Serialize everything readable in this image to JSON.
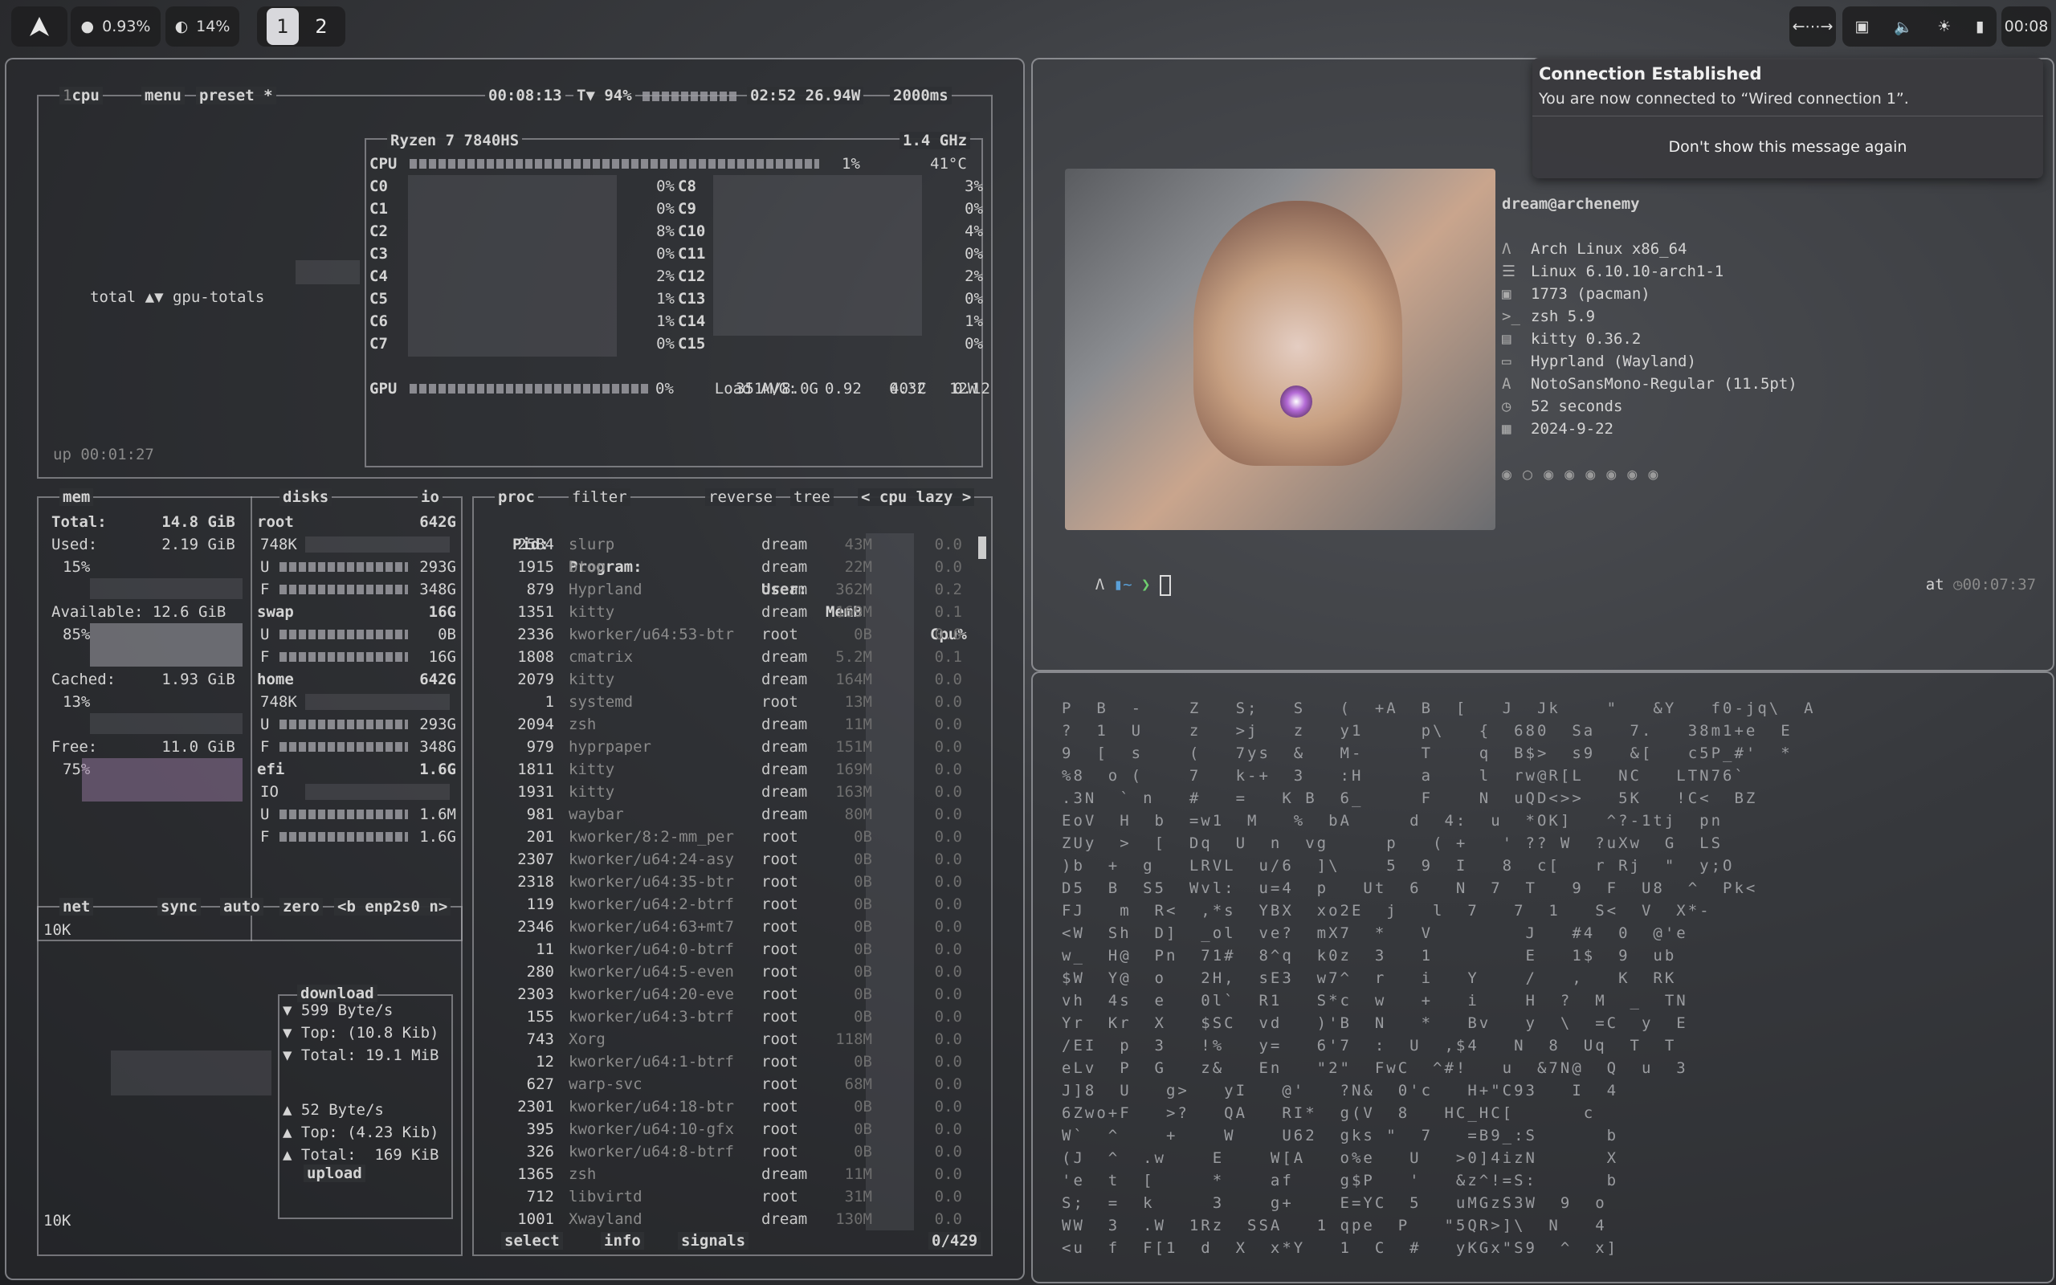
{
  "topbar": {
    "cpu": "0.93%",
    "ram": "14%",
    "workspaces": [
      "1",
      "2"
    ],
    "active_workspace": "1",
    "clock": "00:08",
    "icons": [
      "arch-logo-icon",
      "cpu-icon",
      "ram-icon",
      "network-arrows-icon",
      "display-icon",
      "volume-icon",
      "brightness-icon",
      "battery-icon"
    ]
  },
  "btop": {
    "cpu_box": {
      "tabs": [
        "cpu",
        "menu",
        "preset *"
      ],
      "tab_nums": [
        "1",
        "",
        "p"
      ],
      "uptime_clock": "00:08:13",
      "battery": "T▼ 94%",
      "battery_time": "02:52 26.94W",
      "interval": "2000ms",
      "total_label": "total ▲▼ gpu-totals",
      "up": "up 00:01:27",
      "cpu_name": "Ryzen 7 7840HS",
      "freq": "1.4 GHz",
      "cpu_total_label": "CPU",
      "cpu_total_pct": "1%",
      "cpu_temp": "41°C",
      "cores_left": [
        {
          "name": "C0",
          "pct": "0%"
        },
        {
          "name": "C1",
          "pct": "0%"
        },
        {
          "name": "C2",
          "pct": "8%"
        },
        {
          "name": "C3",
          "pct": "0%"
        },
        {
          "name": "C4",
          "pct": "2%"
        },
        {
          "name": "C5",
          "pct": "1%"
        },
        {
          "name": "C6",
          "pct": "1%"
        },
        {
          "name": "C7",
          "pct": "0%"
        }
      ],
      "cores_right": [
        {
          "name": "C8",
          "pct": "3%"
        },
        {
          "name": "C9",
          "pct": "0%"
        },
        {
          "name": "C10",
          "pct": "4%"
        },
        {
          "name": "C11",
          "pct": "0%"
        },
        {
          "name": "C12",
          "pct": "2%"
        },
        {
          "name": "C13",
          "pct": "0%"
        },
        {
          "name": "C14",
          "pct": "1%"
        },
        {
          "name": "C15",
          "pct": "0%"
        }
      ],
      "load_avg_label": "Load AVG:",
      "load_avg": [
        "0.92",
        "0.32",
        "0.12"
      ],
      "gpu_label": "GPU",
      "gpu_pct": "0%",
      "gpu_mem": "351M/8.0G",
      "gpu_temp": "40°C",
      "gpu_power": "12W"
    },
    "mem_box": {
      "title": "mem",
      "total_label": "Total:",
      "total": "14.8 GiB",
      "used_label": "Used:",
      "used": "2.19 GiB",
      "used_pct": "15%",
      "avail_label": "Available:",
      "avail": "12.6 GiB",
      "avail_pct": "85%",
      "cached_label": "Cached:",
      "cached": "1.93 GiB",
      "cached_pct": "13%",
      "free_label": "Free:",
      "free": "11.0 GiB",
      "free_pct": "75%"
    },
    "disks_box": {
      "title": "disks",
      "io": "io",
      "disks": [
        {
          "name": "root",
          "size": "642G",
          "io": "748K",
          "u": "293G",
          "f": "348G"
        },
        {
          "name": "swap",
          "size": "16G",
          "u": "0B",
          "f": "16G"
        },
        {
          "name": "home",
          "size": "642G",
          "io": "748K",
          "u": "293G",
          "f": "348G"
        },
        {
          "name": "efi",
          "size": "1.6G",
          "io": "IO",
          "u": "1.6M",
          "f": "1.6G"
        }
      ]
    },
    "net_box": {
      "title": "net",
      "tabs": [
        "sync",
        "auto",
        "zero",
        "<b enp2s0 n>"
      ],
      "scale_top": "10K",
      "scale_bottom": "10K",
      "download_title": "download",
      "down_rate": "599 Byte/s",
      "down_top": "Top: (10.8 Kib)",
      "down_total": "Total: 19.1 MiB",
      "up_rate": "52 Byte/s",
      "up_top": "Top: (4.23 Kib)",
      "up_total": "Total:  169 KiB",
      "upload_title": "upload"
    },
    "proc_box": {
      "title": "proc",
      "tabs": [
        "filter",
        "reverse",
        "tree",
        "< cpu lazy >"
      ],
      "headers": {
        "pid": "Pid:",
        "program": "Program:",
        "user": "User:",
        "mem": "MemB",
        "cpu": "Cpu%"
      },
      "rows": [
        [
          "2584",
          "slurp",
          "dream",
          "43M",
          "0.0"
        ],
        [
          "1915",
          "btop",
          "dream",
          "22M",
          "0.0"
        ],
        [
          "879",
          "Hyprland",
          "dream",
          "362M",
          "0.2"
        ],
        [
          "1351",
          "kitty",
          "dream",
          "169M",
          "0.1"
        ],
        [
          "2336",
          "kworker/u64:53-btr",
          "root",
          "0B",
          "0.0"
        ],
        [
          "1808",
          "cmatrix",
          "dream",
          "5.2M",
          "0.1"
        ],
        [
          "2079",
          "kitty",
          "dream",
          "164M",
          "0.0"
        ],
        [
          "1",
          "systemd",
          "root",
          "13M",
          "0.0"
        ],
        [
          "2094",
          "zsh",
          "dream",
          "11M",
          "0.0"
        ],
        [
          "979",
          "hyprpaper",
          "dream",
          "151M",
          "0.0"
        ],
        [
          "1811",
          "kitty",
          "dream",
          "169M",
          "0.0"
        ],
        [
          "1931",
          "kitty",
          "dream",
          "163M",
          "0.0"
        ],
        [
          "981",
          "waybar",
          "dream",
          "80M",
          "0.0"
        ],
        [
          "201",
          "kworker/8:2-mm_per",
          "root",
          "0B",
          "0.0"
        ],
        [
          "2307",
          "kworker/u64:24-asy",
          "root",
          "0B",
          "0.0"
        ],
        [
          "2318",
          "kworker/u64:35-btr",
          "root",
          "0B",
          "0.0"
        ],
        [
          "119",
          "kworker/u64:2-btrf",
          "root",
          "0B",
          "0.0"
        ],
        [
          "2346",
          "kworker/u64:63+mt7",
          "root",
          "0B",
          "0.0"
        ],
        [
          "11",
          "kworker/u64:0-btrf",
          "root",
          "0B",
          "0.0"
        ],
        [
          "280",
          "kworker/u64:5-even",
          "root",
          "0B",
          "0.0"
        ],
        [
          "2303",
          "kworker/u64:20-eve",
          "root",
          "0B",
          "0.0"
        ],
        [
          "155",
          "kworker/u64:3-btrf",
          "root",
          "0B",
          "0.0"
        ],
        [
          "743",
          "Xorg",
          "root",
          "118M",
          "0.0"
        ],
        [
          "12",
          "kworker/u64:1-btrf",
          "root",
          "0B",
          "0.0"
        ],
        [
          "627",
          "warp-svc",
          "root",
          "68M",
          "0.0"
        ],
        [
          "2301",
          "kworker/u64:18-btr",
          "root",
          "0B",
          "0.0"
        ],
        [
          "395",
          "kworker/u64:10-gfx",
          "root",
          "0B",
          "0.0"
        ],
        [
          "326",
          "kworker/u64:8-btrf",
          "root",
          "0B",
          "0.0"
        ],
        [
          "1365",
          "zsh",
          "dream",
          "11M",
          "0.0"
        ],
        [
          "712",
          "libvirtd",
          "root",
          "31M",
          "0.0"
        ],
        [
          "1001",
          "Xwayland",
          "dream",
          "130M",
          "0.0"
        ]
      ],
      "footer": {
        "select": "select",
        "info": "info",
        "signals": "signals",
        "count": "0/429"
      }
    }
  },
  "fetch": {
    "user_host": "dream@archenemy",
    "lines": [
      {
        "icon": "arch-icon",
        "text": "Arch Linux x86_64"
      },
      {
        "icon": "kernel-icon",
        "text": "Linux 6.10.10-arch1-1"
      },
      {
        "icon": "package-icon",
        "text": "1773 (pacman)"
      },
      {
        "icon": "shell-icon",
        "text": "zsh 5.9"
      },
      {
        "icon": "terminal-icon",
        "text": "kitty 0.36.2"
      },
      {
        "icon": "window-icon",
        "text": "Hyprland (Wayland)"
      },
      {
        "icon": "font-icon",
        "text": "NotoSansMono-Regular (11.5pt)"
      },
      {
        "icon": "clock-icon",
        "text": "52 seconds"
      },
      {
        "icon": "calendar-icon",
        "text": "2024-9-22"
      }
    ],
    "prompt_symbol": "❯",
    "prompt_time_label": "at",
    "prompt_time": "00:07:37"
  },
  "notification": {
    "title": "Connection Established",
    "body": "You are now connected to “Wired connection 1”.",
    "action": "Don't show this message again"
  },
  "matrix": {
    "lines": [
      "P  B  -    Z   S;   S   (  +A  B  [   J  Jk    \"   &Y   f0-jq\\  A",
      "?  1  U    z   >j   z   y1     p\\   {  680  Sa   7.   38m1+e  E",
      "9  [  s    (   7ys  &   M-     T    q  B$>  s9   &[   c5P_#'  *",
      "%8  o (    7   k-+  3   :H     a    l  rw@R[L   NC   LTN76`",
      ".3N  ` n   #   =   K B  6_     F    N  uQD<>>   5K   !C<  BZ",
      "EoV  H  b  =w1  M   %  bA     d  4:  u  *OK]   ^?-1tj  pn",
      "ZUy  >  [  Dq  U  n  vg     p   ( +   ' ?? W  ?uXw  G  LS",
      ")b  +  g   LRVL  u/6  ]\\    5  9  I   8  c[   r Rj  \"  y;O",
      "D5  B  S5  Wvl:  u=4  p   Ut  6   N  7  T   9  F  U8  ^  Pk<",
      "FJ   m  R<  ,*s  YBX  xo2E  j   l  7   7  1   S<  V  X*-",
      "<W  Sh  D]  _ol  ve?  mX7  *   V        J   #4  0  @'e",
      "w_  H@  Pn  71#  8^q  k0z  3   1        E   1$  9  ub",
      "$W  Y@  o   2H,  sE3  w7^  r   i   Y    /   ,   K  RK",
      "vh  4s  e   0l`  R1   S*c  w   +   i    H  ?  M  _  TN",
      "Yr  Kr  X   $SC  vd   )'B  N   *   Bv   y  \\  =C  y  E",
      "/EI  p  3   !%   y=   6'7  :  U  ,$4   N  8  Uq  T  T",
      "eLv  P  G   z&   En   \"2\"  FwC  ^#!   u  &7N@  Q  u  3",
      "J]8  U   g>   yI   @'   ?N&  0'c   H+\"C93   I  4",
      "6Zwo+F   >?   QA   RI*  g(V  8   HC_HC[      c",
      "W`  ^    +    W    U62  gks \"  7   =B9_:S      b",
      "(J  ^  .w    E    W[A   o%e   U   >0]4izN      X",
      "'e  t  [     *    af    g$P   '   &z^!=S:      b",
      "S;  =  k     3    g+    E=YC  5   uMGzS3W  9  o",
      "WW  3  .W  1Rz  SSA   1 qpe  P   \"5QR>]\\  N   4",
      "<u  f  F[1  d  X  x*Y   1  C  #   yKGx\"S9  ^  x]"
    ]
  },
  "colors": {
    "accent_purple": "#8a7aa0",
    "prompt_green": "#6fcf6f",
    "prompt_blue": "#5aa0d8"
  }
}
